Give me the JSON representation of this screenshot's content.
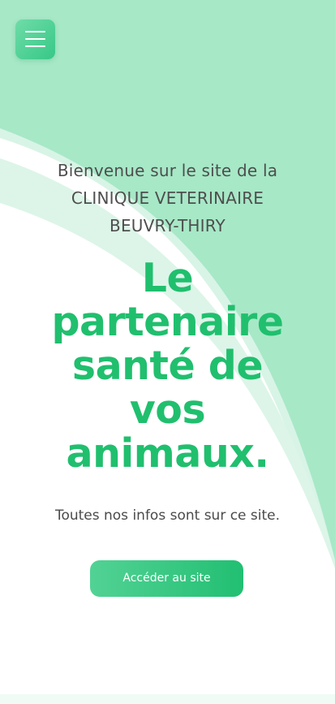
{
  "header": {
    "menu_icon": "hamburger-menu-icon"
  },
  "hero": {
    "welcome_line1": "Bienvenue sur le site de la",
    "welcome_line2": "CLINIQUE VETERINAIRE",
    "welcome_line3": "BEUVRY-THIRY",
    "headline_line1": "Le",
    "headline_line2": "partenaire",
    "headline_line3": "santé de",
    "headline_line4": "vos",
    "headline_line5": "animaux.",
    "subtitle": "Toutes nos infos sont sur ce site.",
    "cta_label": "Accéder au site"
  },
  "colors": {
    "background_green": "#a7e8c7",
    "light_wave": "#d8f4e6",
    "accent": "#20bf6e",
    "text": "#4e4e4e",
    "white": "#ffffff"
  }
}
